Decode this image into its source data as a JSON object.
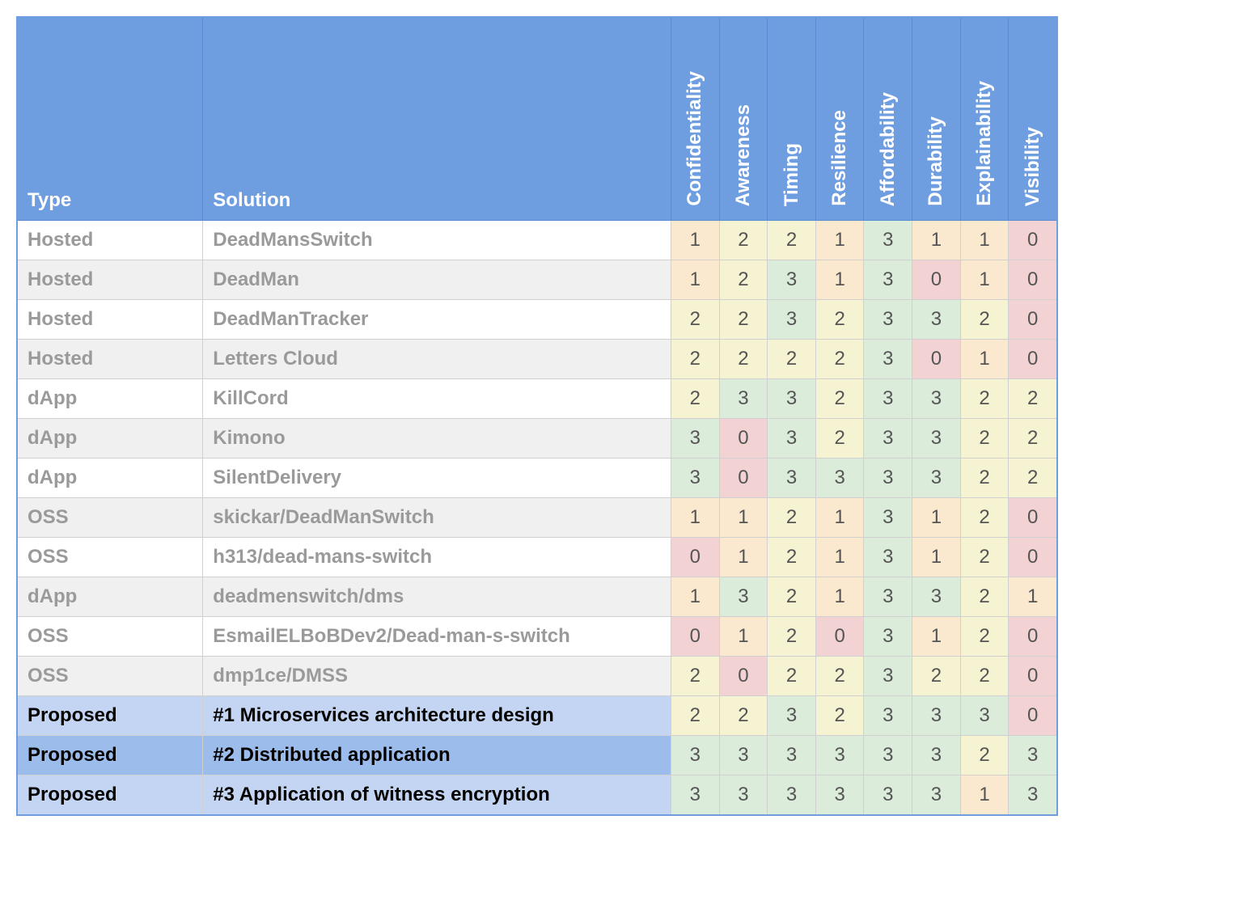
{
  "headers": {
    "type": "Type",
    "solution": "Solution",
    "metrics": [
      "Confidentiality",
      "Awareness",
      "Timing",
      "Resilience",
      "Affordability",
      "Durability",
      "Explainability",
      "Visibility"
    ]
  },
  "rows": [
    {
      "type": "Hosted",
      "solution": "DeadMansSwitch",
      "scores": [
        1,
        2,
        2,
        1,
        3,
        1,
        1,
        0
      ],
      "proposed": false
    },
    {
      "type": "Hosted",
      "solution": "DeadMan",
      "scores": [
        1,
        2,
        3,
        1,
        3,
        0,
        1,
        0
      ],
      "proposed": false
    },
    {
      "type": "Hosted",
      "solution": "DeadManTracker",
      "scores": [
        2,
        2,
        3,
        2,
        3,
        3,
        2,
        0
      ],
      "proposed": false
    },
    {
      "type": "Hosted",
      "solution": "Letters Cloud",
      "scores": [
        2,
        2,
        2,
        2,
        3,
        0,
        1,
        0
      ],
      "proposed": false
    },
    {
      "type": "dApp",
      "solution": "KillCord",
      "scores": [
        2,
        3,
        3,
        2,
        3,
        3,
        2,
        2
      ],
      "proposed": false
    },
    {
      "type": "dApp",
      "solution": "Kimono",
      "scores": [
        3,
        0,
        3,
        2,
        3,
        3,
        2,
        2
      ],
      "proposed": false
    },
    {
      "type": "dApp",
      "solution": "SilentDelivery",
      "scores": [
        3,
        0,
        3,
        3,
        3,
        3,
        2,
        2
      ],
      "proposed": false
    },
    {
      "type": "OSS",
      "solution": "skickar/DeadManSwitch",
      "scores": [
        1,
        1,
        2,
        1,
        3,
        1,
        2,
        0
      ],
      "proposed": false
    },
    {
      "type": "OSS",
      "solution": "h313/dead-mans-switch",
      "scores": [
        0,
        1,
        2,
        1,
        3,
        1,
        2,
        0
      ],
      "proposed": false
    },
    {
      "type": "dApp",
      "solution": "deadmenswitch/dms",
      "scores": [
        1,
        3,
        2,
        1,
        3,
        3,
        2,
        1
      ],
      "proposed": false
    },
    {
      "type": "OSS",
      "solution": "EsmailELBoBDev2/Dead-man-s-switch",
      "scores": [
        0,
        1,
        2,
        0,
        3,
        1,
        2,
        0
      ],
      "proposed": false
    },
    {
      "type": "OSS",
      "solution": "dmp1ce/DMSS",
      "scores": [
        2,
        0,
        2,
        2,
        3,
        2,
        2,
        0
      ],
      "proposed": false
    },
    {
      "type": "Proposed",
      "solution": "#1 Microservices architecture design",
      "scores": [
        2,
        2,
        3,
        2,
        3,
        3,
        3,
        0
      ],
      "proposed": true
    },
    {
      "type": "Proposed",
      "solution": "#2 Distributed application",
      "scores": [
        3,
        3,
        3,
        3,
        3,
        3,
        2,
        3
      ],
      "proposed": true
    },
    {
      "type": "Proposed",
      "solution": "#3 Application of witness encryption",
      "scores": [
        3,
        3,
        3,
        3,
        3,
        3,
        1,
        3
      ],
      "proposed": true
    }
  ],
  "chart_data": {
    "type": "table",
    "title": "",
    "columns": [
      "Type",
      "Solution",
      "Confidentiality",
      "Awareness",
      "Timing",
      "Resilience",
      "Affordability",
      "Durability",
      "Explainability",
      "Visibility"
    ],
    "rows": [
      [
        "Hosted",
        "DeadMansSwitch",
        1,
        2,
        2,
        1,
        3,
        1,
        1,
        0
      ],
      [
        "Hosted",
        "DeadMan",
        1,
        2,
        3,
        1,
        3,
        0,
        1,
        0
      ],
      [
        "Hosted",
        "DeadManTracker",
        2,
        2,
        3,
        2,
        3,
        3,
        2,
        0
      ],
      [
        "Hosted",
        "Letters Cloud",
        2,
        2,
        2,
        2,
        3,
        0,
        1,
        0
      ],
      [
        "dApp",
        "KillCord",
        2,
        3,
        3,
        2,
        3,
        3,
        2,
        2
      ],
      [
        "dApp",
        "Kimono",
        3,
        0,
        3,
        2,
        3,
        3,
        2,
        2
      ],
      [
        "dApp",
        "SilentDelivery",
        3,
        0,
        3,
        3,
        3,
        3,
        2,
        2
      ],
      [
        "OSS",
        "skickar/DeadManSwitch",
        1,
        1,
        2,
        1,
        3,
        1,
        2,
        0
      ],
      [
        "OSS",
        "h313/dead-mans-switch",
        0,
        1,
        2,
        1,
        3,
        1,
        2,
        0
      ],
      [
        "dApp",
        "deadmenswitch/dms",
        1,
        3,
        2,
        1,
        3,
        3,
        2,
        1
      ],
      [
        "OSS",
        "EsmailELBoBDev2/Dead-man-s-switch",
        0,
        1,
        2,
        0,
        3,
        1,
        2,
        0
      ],
      [
        "OSS",
        "dmp1ce/DMSS",
        2,
        0,
        2,
        2,
        3,
        2,
        2,
        0
      ],
      [
        "Proposed",
        "#1 Microservices architecture design",
        2,
        2,
        3,
        2,
        3,
        3,
        3,
        0
      ],
      [
        "Proposed",
        "#2 Distributed application",
        3,
        3,
        3,
        3,
        3,
        3,
        2,
        3
      ],
      [
        "Proposed",
        "#3 Application of witness encryption",
        3,
        3,
        3,
        3,
        3,
        3,
        1,
        3
      ]
    ],
    "value_range": [
      0,
      3
    ]
  }
}
